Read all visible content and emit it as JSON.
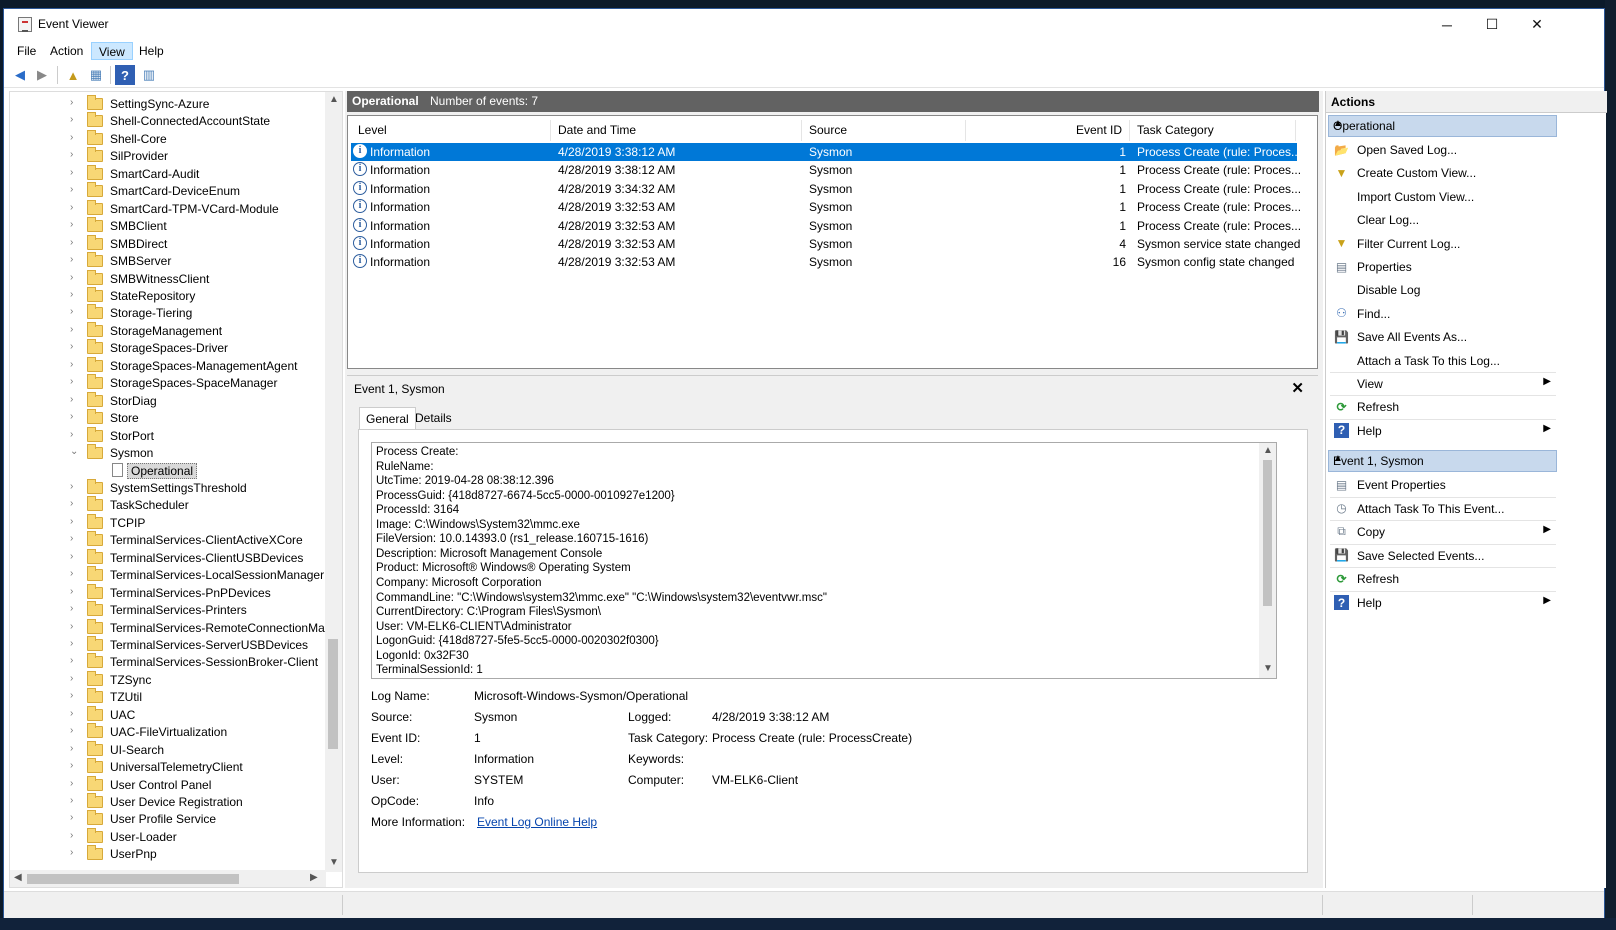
{
  "window": {
    "title": "Event Viewer",
    "minimize": "─",
    "maximize": "☐",
    "close": "✕"
  },
  "menu": [
    "File",
    "Action",
    "View",
    "Help"
  ],
  "tree": {
    "items": [
      {
        "label": "SettingSync-Azure",
        "expander": "›"
      },
      {
        "label": "Shell-ConnectedAccountState",
        "expander": "›"
      },
      {
        "label": "Shell-Core",
        "expander": "›"
      },
      {
        "label": "SilProvider",
        "expander": "›"
      },
      {
        "label": "SmartCard-Audit",
        "expander": "›"
      },
      {
        "label": "SmartCard-DeviceEnum",
        "expander": "›"
      },
      {
        "label": "SmartCard-TPM-VCard-Module",
        "expander": "›"
      },
      {
        "label": "SMBClient",
        "expander": "›"
      },
      {
        "label": "SMBDirect",
        "expander": "›"
      },
      {
        "label": "SMBServer",
        "expander": "›"
      },
      {
        "label": "SMBWitnessClient",
        "expander": "›"
      },
      {
        "label": "StateRepository",
        "expander": "›"
      },
      {
        "label": "Storage-Tiering",
        "expander": "›"
      },
      {
        "label": "StorageManagement",
        "expander": "›"
      },
      {
        "label": "StorageSpaces-Driver",
        "expander": "›"
      },
      {
        "label": "StorageSpaces-ManagementAgent",
        "expander": "›"
      },
      {
        "label": "StorageSpaces-SpaceManager",
        "expander": "›"
      },
      {
        "label": "StorDiag",
        "expander": "›"
      },
      {
        "label": "Store",
        "expander": "›"
      },
      {
        "label": "StorPort",
        "expander": "›"
      },
      {
        "label": "Sysmon",
        "expander": "⌄"
      },
      {
        "label": "Operational",
        "child": true
      },
      {
        "label": "SystemSettingsThreshold",
        "expander": "›"
      },
      {
        "label": "TaskScheduler",
        "expander": "›"
      },
      {
        "label": "TCPIP",
        "expander": "›"
      },
      {
        "label": "TerminalServices-ClientActiveXCore",
        "expander": "›"
      },
      {
        "label": "TerminalServices-ClientUSBDevices",
        "expander": "›"
      },
      {
        "label": "TerminalServices-LocalSessionManager",
        "expander": "›"
      },
      {
        "label": "TerminalServices-PnPDevices",
        "expander": "›"
      },
      {
        "label": "TerminalServices-Printers",
        "expander": "›"
      },
      {
        "label": "TerminalServices-RemoteConnectionMana",
        "expander": "›"
      },
      {
        "label": "TerminalServices-ServerUSBDevices",
        "expander": "›"
      },
      {
        "label": "TerminalServices-SessionBroker-Client",
        "expander": "›"
      },
      {
        "label": "TZSync",
        "expander": "›"
      },
      {
        "label": "TZUtil",
        "expander": "›"
      },
      {
        "label": "UAC",
        "expander": "›"
      },
      {
        "label": "UAC-FileVirtualization",
        "expander": "›"
      },
      {
        "label": "UI-Search",
        "expander": "›"
      },
      {
        "label": "UniversalTelemetryClient",
        "expander": "›"
      },
      {
        "label": "User Control Panel",
        "expander": "›"
      },
      {
        "label": "User Device Registration",
        "expander": "›"
      },
      {
        "label": "User Profile Service",
        "expander": "›"
      },
      {
        "label": "User-Loader",
        "expander": "›"
      },
      {
        "label": "UserPnp",
        "expander": "›"
      }
    ]
  },
  "events_panel": {
    "log_name": "Operational",
    "count_text": "Number of events: 7",
    "columns": [
      "Level",
      "Date and Time",
      "Source",
      "Event ID",
      "Task Category"
    ],
    "rows": [
      {
        "level": "Information",
        "datetime": "4/28/2019 3:38:12 AM",
        "source": "Sysmon",
        "event_id": "1",
        "category": "Process Create (rule: Proces...",
        "selected": true
      },
      {
        "level": "Information",
        "datetime": "4/28/2019 3:38:12 AM",
        "source": "Sysmon",
        "event_id": "1",
        "category": "Process Create (rule: Proces..."
      },
      {
        "level": "Information",
        "datetime": "4/28/2019 3:34:32 AM",
        "source": "Sysmon",
        "event_id": "1",
        "category": "Process Create (rule: Proces..."
      },
      {
        "level": "Information",
        "datetime": "4/28/2019 3:32:53 AM",
        "source": "Sysmon",
        "event_id": "1",
        "category": "Process Create (rule: Proces..."
      },
      {
        "level": "Information",
        "datetime": "4/28/2019 3:32:53 AM",
        "source": "Sysmon",
        "event_id": "1",
        "category": "Process Create (rule: Proces..."
      },
      {
        "level": "Information",
        "datetime": "4/28/2019 3:32:53 AM",
        "source": "Sysmon",
        "event_id": "4",
        "category": "Sysmon service state changed"
      },
      {
        "level": "Information",
        "datetime": "4/28/2019 3:32:53 AM",
        "source": "Sysmon",
        "event_id": "16",
        "category": "Sysmon config state changed"
      }
    ]
  },
  "details": {
    "title": "Event 1, Sysmon",
    "close": "✕",
    "tabs": [
      "General",
      "Details"
    ],
    "description_lines": [
      "Process Create:",
      "RuleName:",
      "UtcTime: 2019-04-28 08:38:12.396",
      "ProcessGuid: {418d8727-6674-5cc5-0000-0010927e1200}",
      "ProcessId: 3164",
      "Image: C:\\Windows\\System32\\mmc.exe",
      "FileVersion: 10.0.14393.0 (rs1_release.160715-1616)",
      "Description: Microsoft Management Console",
      "Product: Microsoft® Windows® Operating System",
      "Company: Microsoft Corporation",
      "CommandLine: \"C:\\Windows\\system32\\mmc.exe\" \"C:\\Windows\\system32\\eventvwr.msc\"",
      "CurrentDirectory: C:\\Program Files\\Sysmon\\",
      "User: VM-ELK6-CLIENT\\Administrator",
      "LogonGuid: {418d8727-5fe5-5cc5-0000-0020302f0300}",
      "LogonId: 0x32F30",
      "TerminalSessionId: 1"
    ],
    "fields": {
      "log_name_label": "Log Name:",
      "log_name": "Microsoft-Windows-Sysmon/Operational",
      "source_label": "Source:",
      "source": "Sysmon",
      "logged_label": "Logged:",
      "logged": "4/28/2019 3:38:12 AM",
      "event_id_label": "Event ID:",
      "event_id": "1",
      "task_category_label": "Task Category:",
      "task_category": "Process Create (rule: ProcessCreate)",
      "level_label": "Level:",
      "level": "Information",
      "keywords_label": "Keywords:",
      "user_label": "User:",
      "user": "SYSTEM",
      "computer_label": "Computer:",
      "computer": "VM-ELK6-Client",
      "opcode_label": "OpCode:",
      "opcode": "Info",
      "more_info_label": "More Information:",
      "more_info_link": "Event Log Online Help"
    }
  },
  "actions": {
    "title": "Actions",
    "group1": "Operational",
    "group1_items": [
      {
        "label": "Open Saved Log...",
        "icon": "open-folder-icon",
        "glyph": "📂"
      },
      {
        "label": "Create Custom View...",
        "icon": "filter-icon",
        "glyph": "▼"
      },
      {
        "label": "Import Custom View...",
        "icon": "",
        "glyph": ""
      },
      {
        "label": "Clear Log...",
        "icon": "",
        "glyph": ""
      },
      {
        "label": "Filter Current Log...",
        "icon": "filter-icon",
        "glyph": "▼"
      },
      {
        "label": "Properties",
        "icon": "properties-icon",
        "glyph": "▤"
      },
      {
        "label": "Disable Log",
        "icon": "",
        "glyph": ""
      },
      {
        "label": "Find...",
        "icon": "binoculars-icon",
        "glyph": "⚇"
      },
      {
        "label": "Save All Events As...",
        "icon": "save-icon",
        "glyph": "💾"
      },
      {
        "label": "Attach a Task To this Log...",
        "icon": "",
        "glyph": ""
      },
      {
        "label": "View",
        "icon": "",
        "glyph": "",
        "submenu": true
      },
      {
        "label": "Refresh",
        "icon": "refresh-icon",
        "glyph": "⟳"
      },
      {
        "label": "Help",
        "icon": "help-icon",
        "glyph": "?",
        "submenu": true
      }
    ],
    "group2": "Event 1, Sysmon",
    "group2_items": [
      {
        "label": "Event Properties",
        "icon": "properties-icon",
        "glyph": "▤"
      },
      {
        "label": "Attach Task To This Event...",
        "icon": "task-icon",
        "glyph": "◷"
      },
      {
        "label": "Copy",
        "icon": "copy-icon",
        "glyph": "⧉",
        "submenu": true
      },
      {
        "label": "Save Selected Events...",
        "icon": "save-icon",
        "glyph": "💾"
      },
      {
        "label": "Refresh",
        "icon": "refresh-icon",
        "glyph": "⟳"
      },
      {
        "label": "Help",
        "icon": "help-icon",
        "glyph": "?",
        "submenu": true
      }
    ]
  },
  "colors": {
    "selection": "#0078d7",
    "header_bar": "#626262",
    "group_head": "#c8d9ed",
    "link": "#0645ad"
  }
}
